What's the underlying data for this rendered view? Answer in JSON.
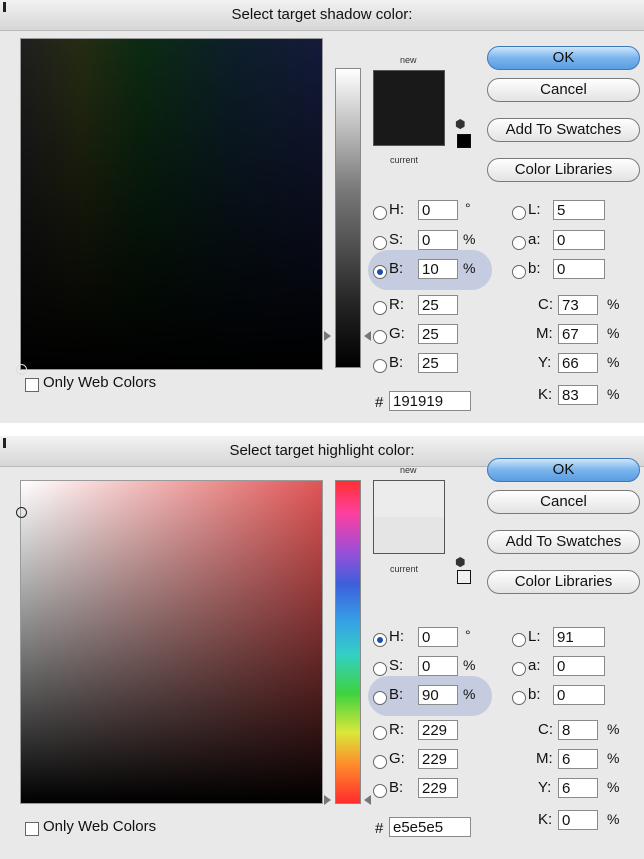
{
  "dialogs": [
    {
      "title": "Select target shadow color:",
      "swatch_new_label": "new",
      "swatch_current_label": "current",
      "new_color": "#191919",
      "current_color": "#191919",
      "buttons": {
        "ok": "OK",
        "cancel": "Cancel",
        "add": "Add To Swatches",
        "libraries": "Color Libraries"
      },
      "selected_radio": "B",
      "hsb": {
        "h": "0",
        "s": "0",
        "b": "10"
      },
      "rgb": {
        "r": "25",
        "g": "25",
        "b": "25"
      },
      "lab": {
        "l": "5",
        "a": "0",
        "b": "0"
      },
      "cmyk": {
        "c": "73",
        "m": "67",
        "y": "66",
        "k": "83"
      },
      "hex": "191919",
      "labels": {
        "h": "H:",
        "s": "S:",
        "b": "B:",
        "r": "R:",
        "g": "G:",
        "b2": "B:",
        "l": "L:",
        "a": "a:",
        "lb": "b:",
        "c": "C:",
        "m": "M:",
        "y": "Y:",
        "k": "K:",
        "hash": "#",
        "deg": "°",
        "pct": "%"
      },
      "only_web_colors": "Only Web Colors"
    },
    {
      "title": "Select target highlight color:",
      "swatch_new_label": "new",
      "swatch_current_label": "current",
      "new_color": "#e5e5e5",
      "current_color": "#ececec",
      "buttons": {
        "ok": "OK",
        "cancel": "Cancel",
        "add": "Add To Swatches",
        "libraries": "Color Libraries"
      },
      "selected_radio": "H",
      "hsb": {
        "h": "0",
        "s": "0",
        "b": "90"
      },
      "rgb": {
        "r": "229",
        "g": "229",
        "b": "229"
      },
      "lab": {
        "l": "91",
        "a": "0",
        "b": "0"
      },
      "cmyk": {
        "c": "8",
        "m": "6",
        "y": "6",
        "k": "0"
      },
      "hex": "e5e5e5",
      "labels": {
        "h": "H:",
        "s": "S:",
        "b": "B:",
        "r": "R:",
        "g": "G:",
        "b2": "B:",
        "l": "L:",
        "a": "a:",
        "lb": "b:",
        "c": "C:",
        "m": "M:",
        "y": "Y:",
        "k": "K:",
        "hash": "#",
        "deg": "°",
        "pct": "%"
      },
      "only_web_colors": "Only Web Colors"
    }
  ],
  "icons": {
    "gamut": "cube-icon",
    "web_chip": "web-safe-swatch-icon"
  }
}
